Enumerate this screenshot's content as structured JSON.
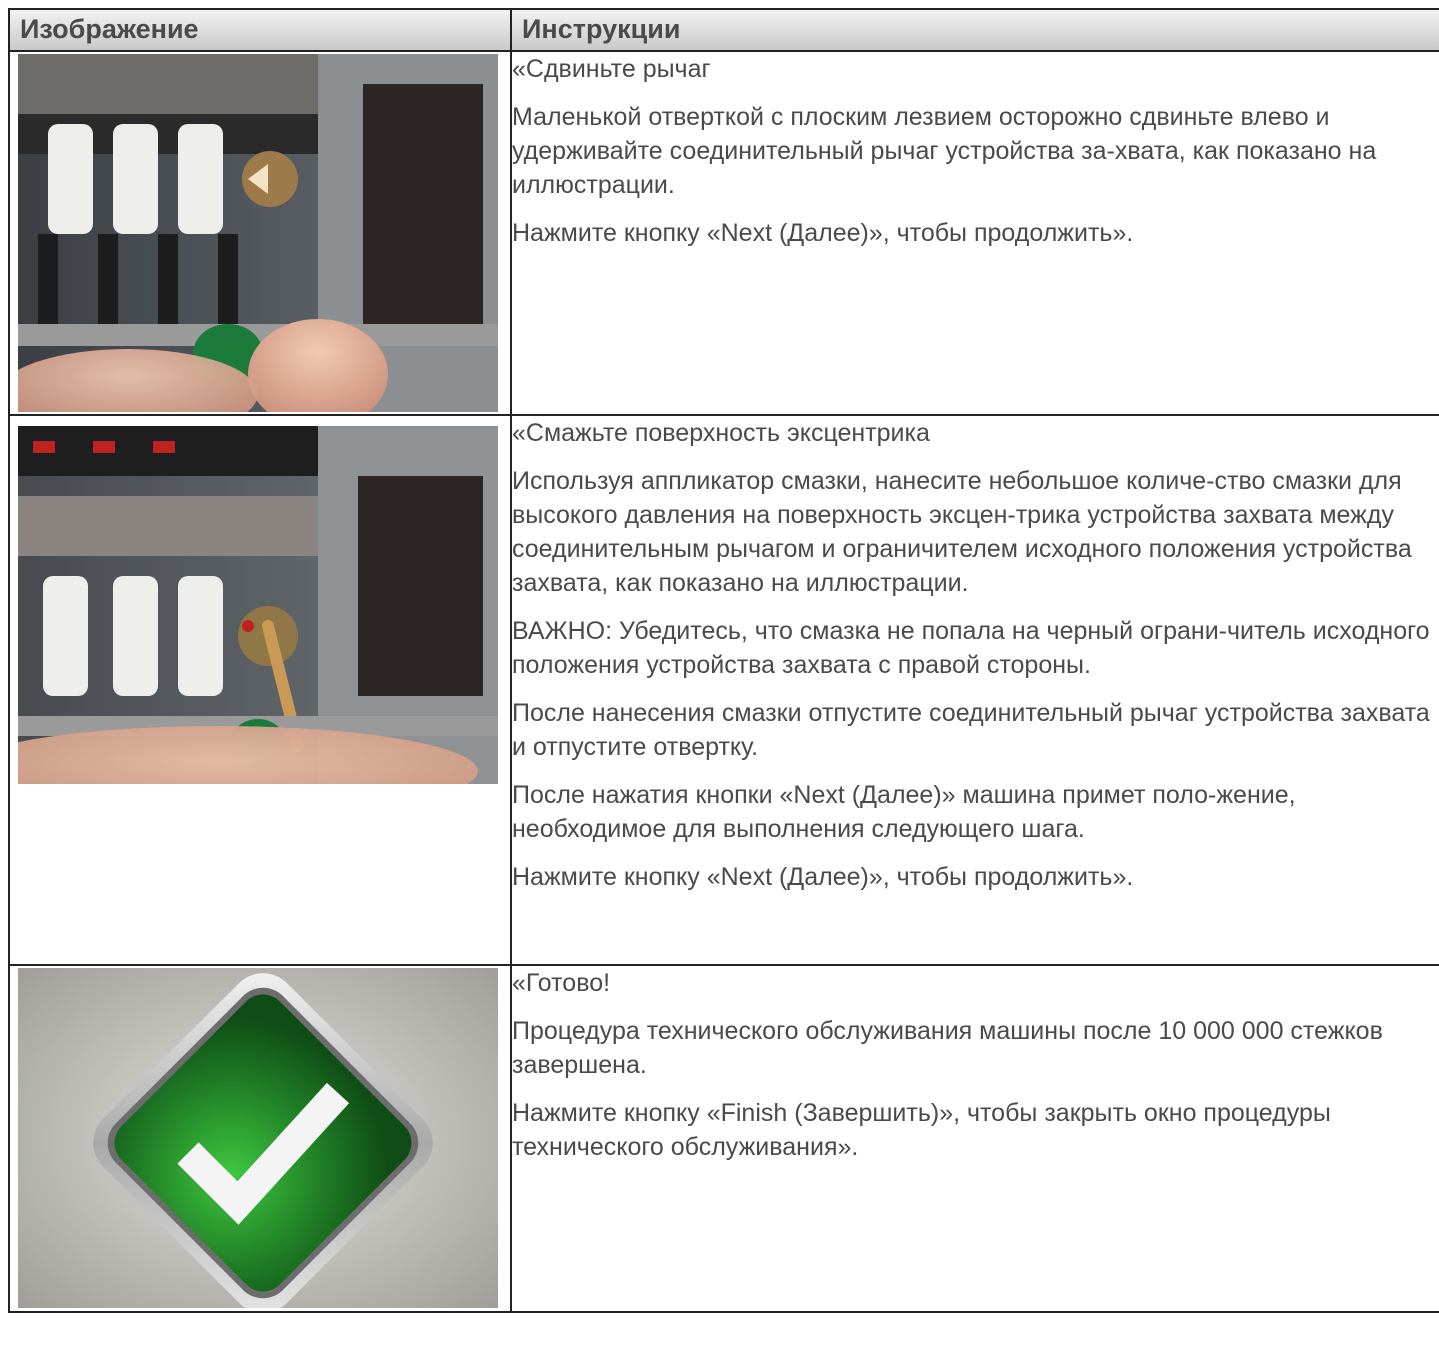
{
  "table": {
    "headers": [
      "Изображение",
      "Инструкции"
    ],
    "rows": [
      {
        "image_icon": "screwdriver-lever-photo",
        "paragraphs": [
          "«Сдвиньте рычаг",
          "Маленькой отверткой с плоским лезвием осторожно сдвиньте влево и удерживайте соединительный рычаг устройства за-хвата, как показано на иллюстрации.",
          "Нажмите кнопку «Next (Далее)», чтобы продолжить»."
        ]
      },
      {
        "image_icon": "grease-applicator-photo",
        "paragraphs": [
          "«Смажьте поверхность эксцентрика",
          "Используя аппликатор смазки, нанесите небольшое количе-ство смазки для высокого давления на поверхность эксцен-трика устройства захвата между соединительным рычагом и ограничителем исходного положения устройства захвата, как показано на иллюстрации.",
          "ВАЖНО: Убедитесь, что смазка не попала на черный ограни-читель исходного положения устройства захвата с правой стороны.",
          "После нанесения смазки отпустите соединительный рычаг устройства захвата и отпустите отвертку.",
          "После нажатия кнопки «Next (Далее)» машина примет поло-жение, необходимое для выполнения следующего шага.",
          "Нажмите кнопку «Next (Далее)», чтобы продолжить»."
        ]
      },
      {
        "image_icon": "green-checkmark-icon",
        "paragraphs": [
          "«Готово!",
          "Процедура технического обслуживания машины после 10 000 000 стежков завершена.",
          "Нажмите кнопку «Finish (Завершить)», чтобы закрыть окно процедуры технического обслуживания»."
        ]
      }
    ]
  },
  "colors": {
    "text": "#4a4a4a",
    "border": "#222222",
    "check_green": "#2e8f2e"
  }
}
